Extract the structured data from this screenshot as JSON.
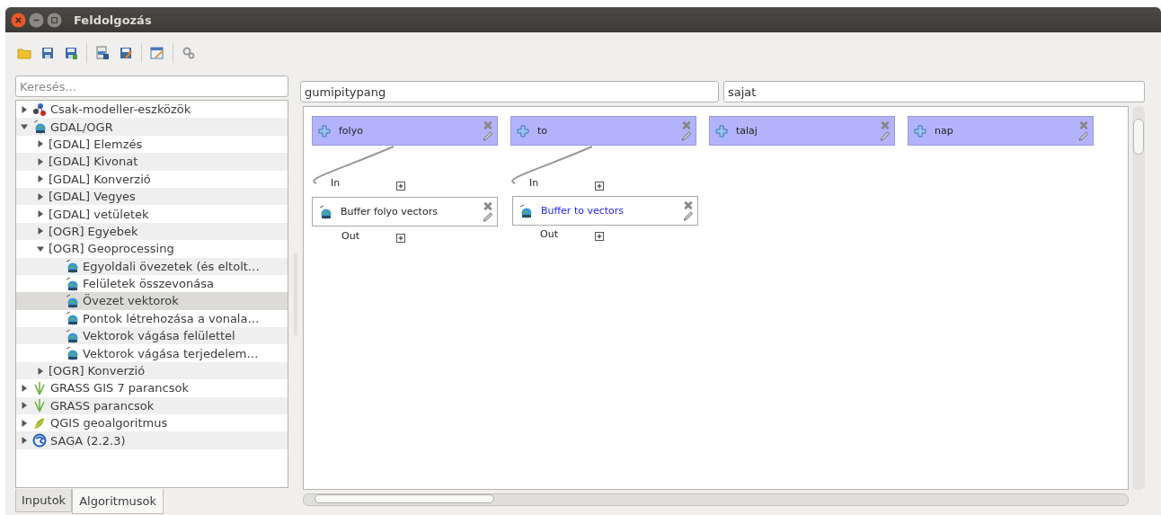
{
  "window": {
    "title": "Feldolgozás"
  },
  "search": {
    "placeholder": "Keresés..."
  },
  "tree": [
    {
      "label": "Csak-modeller-eszközök",
      "kind": "modeller",
      "expanded": false,
      "selected": false
    },
    {
      "label": "GDAL/OGR",
      "kind": "gdal",
      "expanded": true,
      "selected": false,
      "children": [
        {
          "label": "[GDAL] Elemzés",
          "expanded": false,
          "selected": false
        },
        {
          "label": "[GDAL] Kivonat",
          "expanded": false,
          "selected": false
        },
        {
          "label": "[GDAL] Konverzió",
          "expanded": false,
          "selected": false
        },
        {
          "label": "[GDAL] Vegyes",
          "expanded": false,
          "selected": false
        },
        {
          "label": "[GDAL] vetületek",
          "expanded": false,
          "selected": false
        },
        {
          "label": "[OGR] Egyebek",
          "expanded": false,
          "selected": false
        },
        {
          "label": "[OGR] Geoprocessing",
          "expanded": true,
          "selected": false,
          "children": [
            {
              "label": "Egyoldali övezetek (és eltolt…",
              "kind": "gdal",
              "selected": false
            },
            {
              "label": "Felületek összevonása",
              "kind": "gdal",
              "selected": false
            },
            {
              "label": "Övezet vektorok",
              "kind": "gdal",
              "selected": true
            },
            {
              "label": "Pontok létrehozása a vonala…",
              "kind": "gdal",
              "selected": false
            },
            {
              "label": "Vektorok vágása felülettel",
              "kind": "gdal",
              "selected": false
            },
            {
              "label": "Vektorok vágása terjedelem…",
              "kind": "gdal",
              "selected": false
            }
          ]
        },
        {
          "label": "[OGR] Konverzió",
          "expanded": false,
          "selected": false
        }
      ]
    },
    {
      "label": "GRASS GIS 7 parancsok",
      "kind": "grass",
      "expanded": false,
      "selected": false
    },
    {
      "label": "GRASS parancsok",
      "kind": "grass",
      "expanded": false,
      "selected": false
    },
    {
      "label": "QGIS geoalgoritmus",
      "kind": "qgis",
      "expanded": false,
      "selected": false
    },
    {
      "label": "SAGA (2.2.3)",
      "kind": "saga",
      "expanded": false,
      "selected": false
    }
  ],
  "tabs": [
    {
      "label": "Inputok",
      "selected": false
    },
    {
      "label": "Algoritmusok",
      "selected": true
    }
  ],
  "model": {
    "name": "gumipitypang",
    "group": "sajat"
  },
  "inputs": [
    {
      "label": "folyo"
    },
    {
      "label": "to"
    },
    {
      "label": "talaj"
    },
    {
      "label": "nap"
    }
  ],
  "algorithms": [
    {
      "label": "Buffer folyo vectors",
      "in_label": "In",
      "out_label": "Out",
      "highlighted": false
    },
    {
      "label": "Buffer to vectors",
      "in_label": "In",
      "out_label": "Out",
      "highlighted": true
    }
  ]
}
